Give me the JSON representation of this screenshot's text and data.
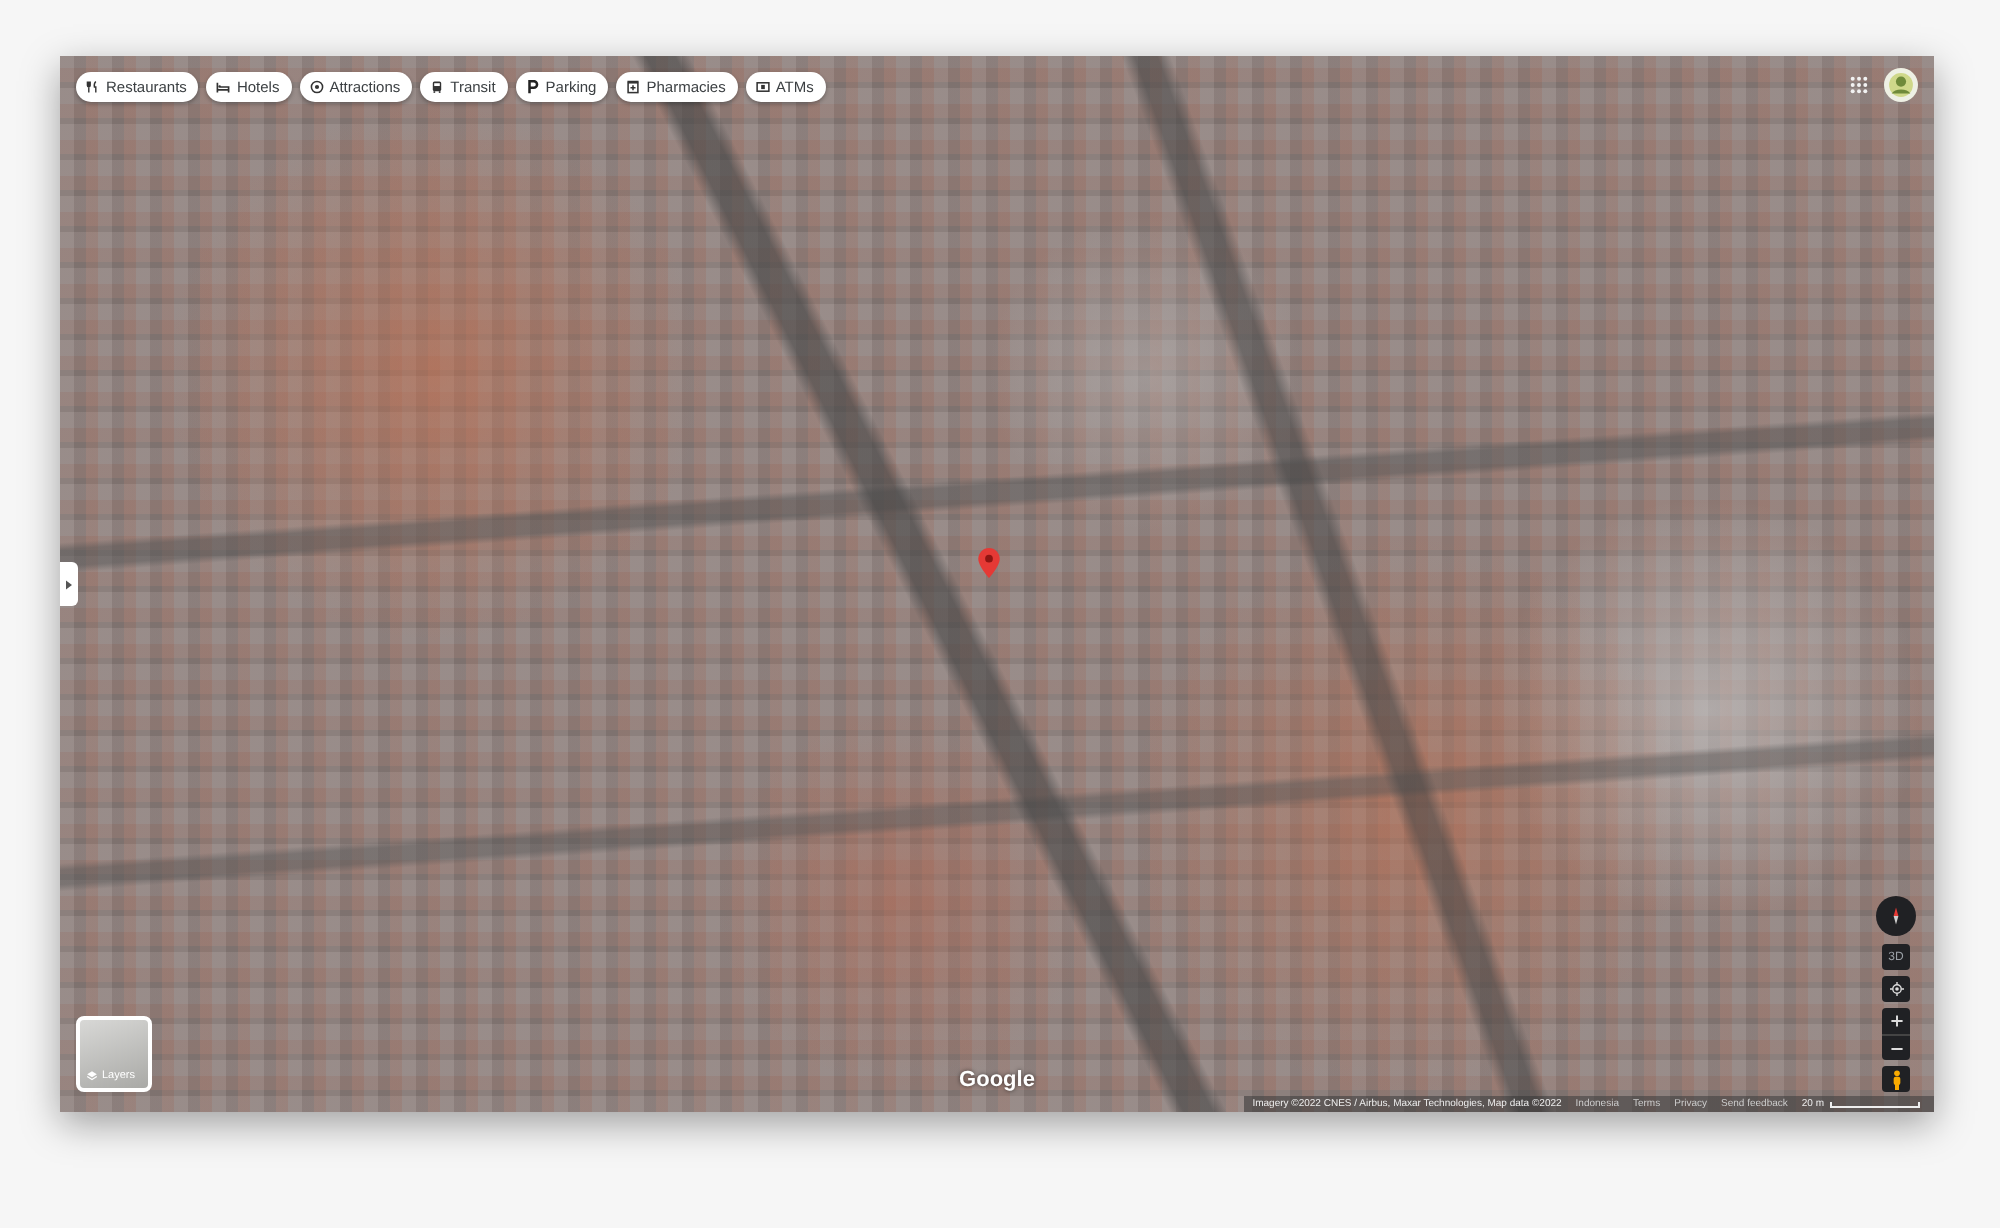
{
  "category_chips": [
    {
      "kind": "restaurants",
      "label": "Restaurants"
    },
    {
      "kind": "hotels",
      "label": "Hotels"
    },
    {
      "kind": "attractions",
      "label": "Attractions"
    },
    {
      "kind": "transit",
      "label": "Transit"
    },
    {
      "kind": "parking",
      "label": "Parking"
    },
    {
      "kind": "pharmacies",
      "label": "Pharmacies"
    },
    {
      "kind": "atms",
      "label": "ATMs"
    }
  ],
  "layers_button": {
    "label": "Layers"
  },
  "map_controls": [
    {
      "kind": "compass"
    },
    {
      "kind": "tilt",
      "label": "3D"
    },
    {
      "kind": "locate"
    },
    {
      "kind": "zoom_in"
    },
    {
      "kind": "zoom_out"
    },
    {
      "kind": "street_view"
    }
  ],
  "logo": "Google",
  "footer": {
    "attribution": "Imagery ©2022 CNES / Airbus, Maxar Technologies, Map data ©2022",
    "links": [
      "Indonesia",
      "Terms",
      "Privacy",
      "Send feedback"
    ],
    "scale": "20 m"
  }
}
